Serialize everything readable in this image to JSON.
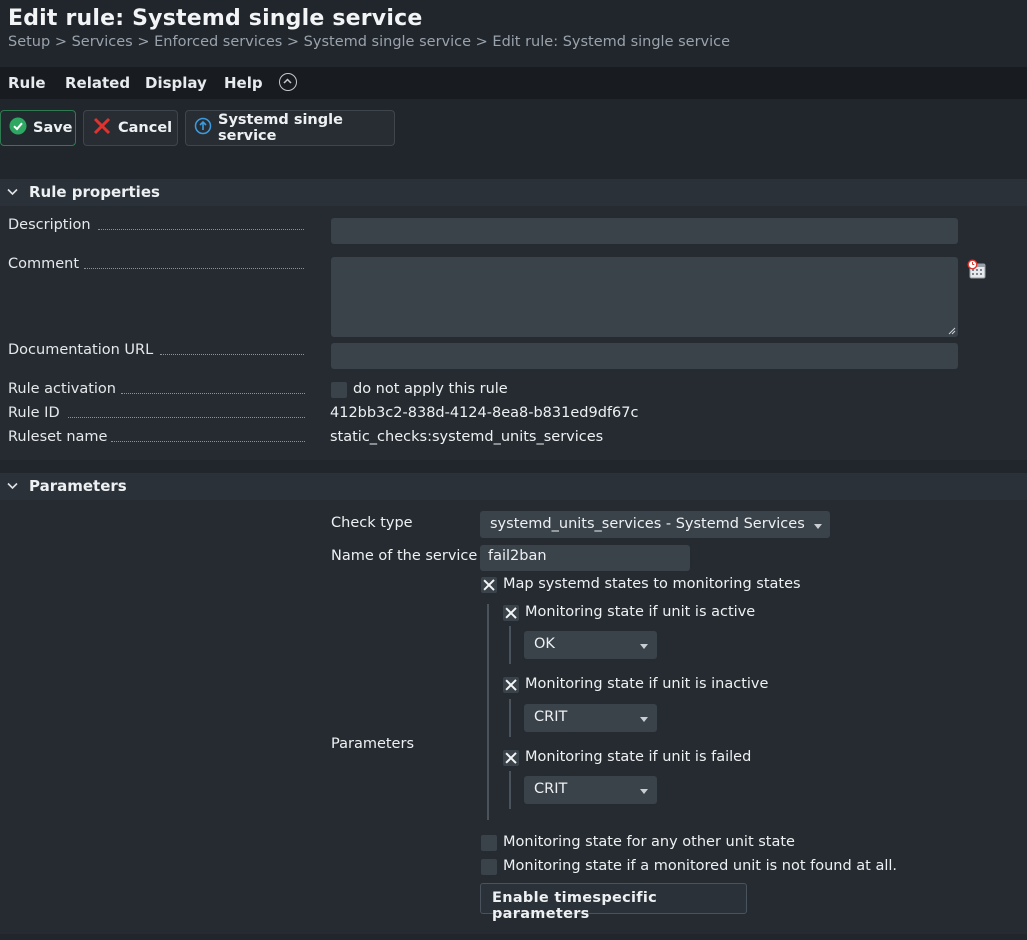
{
  "header": {
    "title": "Edit rule: Systemd single service",
    "breadcrumb": [
      "Setup",
      "Services",
      "Enforced services",
      "Systemd single service",
      "Edit rule: Systemd single service"
    ],
    "separator": ">"
  },
  "menubar": {
    "items": [
      "Rule",
      "Related",
      "Display",
      "Help"
    ]
  },
  "toolbar": {
    "save_label": "Save",
    "cancel_label": "Cancel",
    "ruleset_label": "Systemd single service"
  },
  "rule_properties": {
    "title": "Rule properties",
    "description_label": "Description",
    "description_value": "",
    "comment_label": "Comment",
    "comment_value": "",
    "doc_url_label": "Documentation URL",
    "doc_url_value": "",
    "activation_label": "Rule activation",
    "activation_checkbox_label": "do not apply this rule",
    "activation_checked": false,
    "rule_id_label": "Rule ID",
    "rule_id_value": "412bb3c2-838d-4124-8ea8-b831ed9df67c",
    "ruleset_name_label": "Ruleset name",
    "ruleset_name_value": "static_checks:systemd_units_services"
  },
  "parameters": {
    "title": "Parameters",
    "check_type_label": "Check type",
    "check_type_value": "systemd_units_services - Systemd Services",
    "service_name_label": "Name of the service",
    "service_name_value": "fail2ban",
    "params_label": "Parameters",
    "map_states_label": "Map systemd states to monitoring states",
    "map_states_checked": true,
    "active_label": "Monitoring state if unit is active",
    "active_checked": true,
    "active_value": "OK",
    "inactive_label": "Monitoring state if unit is inactive",
    "inactive_checked": true,
    "inactive_value": "CRIT",
    "failed_label": "Monitoring state if unit is failed",
    "failed_checked": true,
    "failed_value": "CRIT",
    "other_state_label": "Monitoring state for any other unit state",
    "other_state_checked": false,
    "not_found_label": "Monitoring state if a monitored unit is not found at all.",
    "not_found_checked": false,
    "timespecific_button": "Enable timespecific parameters"
  },
  "icons": {
    "save": "check-circle-icon",
    "cancel": "red-x-icon",
    "ruleset": "up-arrow-circle-icon",
    "comment_stamp": "calendar-clock-icon",
    "collapse": "chevron-up-circle-icon"
  },
  "colors": {
    "background": "#21262c",
    "menubar": "#181c21",
    "section_header": "#2b3138",
    "input": "#3a424a",
    "save_green": "#2ea763",
    "cancel_red": "#e0332f",
    "info_blue": "#3b9be0"
  }
}
